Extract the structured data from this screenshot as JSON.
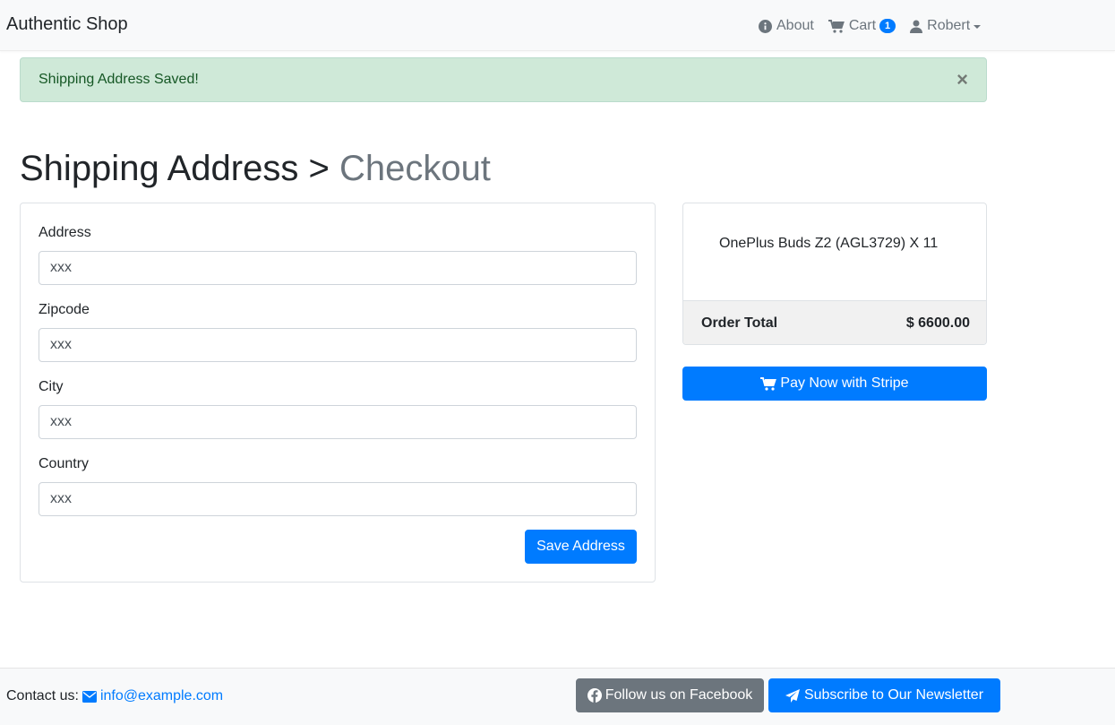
{
  "navbar": {
    "brand": "Authentic Shop",
    "about_label": "About",
    "cart_label": "Cart",
    "cart_count": "1",
    "user_label": "Robert"
  },
  "alert": {
    "message": "Shipping Address Saved!",
    "close_symbol": "×"
  },
  "page": {
    "title_main": "Shipping Address >",
    "title_muted": "Checkout"
  },
  "form": {
    "address_label": "Address",
    "address_value": "xxx",
    "zipcode_label": "Zipcode",
    "zipcode_value": "xxx",
    "city_label": "City",
    "city_value": "xxx",
    "country_label": "Country",
    "country_value": "xxx",
    "save_label": "Save Address"
  },
  "order": {
    "item": "OnePlus Buds Z2 (AGL3729) X 11",
    "total_label": "Order Total",
    "total_value": "$ 6600.00",
    "pay_label": "Pay Now with Stripe"
  },
  "footer": {
    "contact_label": "Contact us:",
    "email": "info@example.com",
    "facebook_label": "Follow us on Facebook",
    "newsletter_label": "Subscribe to Our Newsletter"
  },
  "colors": {
    "primary": "#007bff",
    "secondary": "#6c757d",
    "success_bg": "#cfe9d8",
    "navbar_bg": "#f8f9fa"
  },
  "icons": [
    "info-circle-icon",
    "shopping-cart-icon",
    "user-icon",
    "envelope-icon",
    "facebook-icon",
    "paper-plane-icon",
    "close-icon"
  ]
}
